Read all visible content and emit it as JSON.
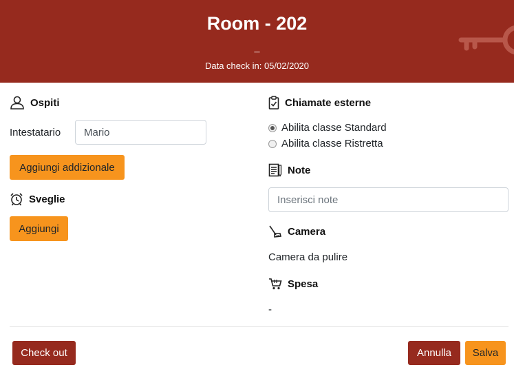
{
  "header": {
    "title": "Room - 202",
    "subtitle": "_",
    "checkin": "Data check in: 05/02/2020",
    "key_icon": "key-icon"
  },
  "guests": {
    "title": "Ospiti",
    "icon": "user-icon",
    "holder_label": "Intestatario",
    "holder_value": "Mario",
    "add_button": "Aggiungi addizionale"
  },
  "wakeups": {
    "title": "Sveglie",
    "icon": "alarm-clock-icon",
    "add_button": "Aggiungi"
  },
  "calls": {
    "title": "Chiamate esterne",
    "icon": "clipboard-icon",
    "options": [
      "Abilita classe Standard",
      "Abilita classe Ristretta"
    ],
    "selected": 0
  },
  "notes": {
    "title": "Note",
    "icon": "notes-icon",
    "placeholder": "Inserisci note",
    "value": ""
  },
  "room": {
    "title": "Camera",
    "icon": "vacuum-icon",
    "status": "Camera da pulire"
  },
  "spending": {
    "title": "Spesa",
    "icon": "cart-icon",
    "value": "-"
  },
  "footer": {
    "checkout": "Check out",
    "cancel": "Annulla",
    "save": "Salva"
  },
  "colors": {
    "primary": "#962a1e",
    "accent": "#f7941d"
  }
}
